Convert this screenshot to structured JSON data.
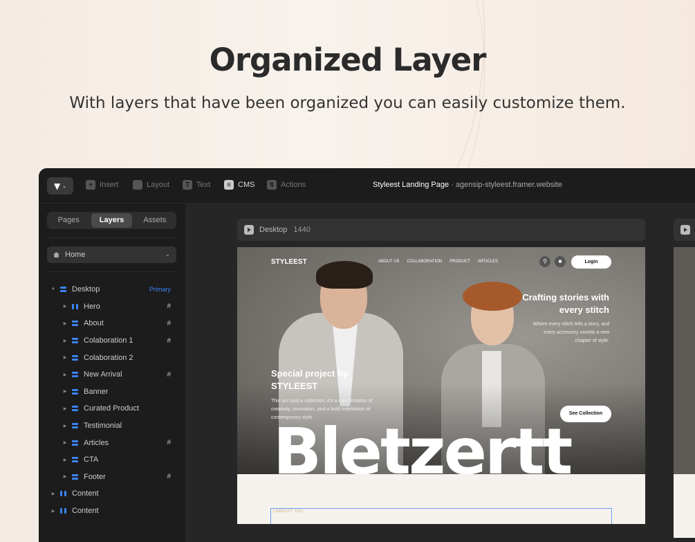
{
  "header": {
    "title": "Organized Layer",
    "subtitle": "With layers that have been organized you can easily customize them."
  },
  "toolbar": {
    "insert": "Insert",
    "layout": "Layout",
    "text": "Text",
    "cms": "CMS",
    "actions": "Actions",
    "project_title": "Styleest Landing Page",
    "project_url": "agensip-styleest.framer.website"
  },
  "sidebar": {
    "tabs": [
      "Pages",
      "Layers",
      "Assets"
    ],
    "page_select": "Home",
    "root": {
      "label": "Desktop",
      "tag": "Primary"
    },
    "layers": [
      {
        "label": "Hero",
        "hash": "#"
      },
      {
        "label": "About",
        "hash": "#"
      },
      {
        "label": "Colaboration 1",
        "hash": "#"
      },
      {
        "label": "Colaboration 2",
        "hash": ""
      },
      {
        "label": "New Arrival",
        "hash": "#"
      },
      {
        "label": "Banner",
        "hash": ""
      },
      {
        "label": "Curated Product",
        "hash": ""
      },
      {
        "label": "Testimonial",
        "hash": ""
      },
      {
        "label": "Articles",
        "hash": "#"
      },
      {
        "label": "CTA",
        "hash": ""
      },
      {
        "label": "Footer",
        "hash": "#"
      }
    ],
    "bottom_items": [
      "Content",
      "Content"
    ]
  },
  "canvas": {
    "frame_name": "Desktop",
    "frame_size": "1440"
  },
  "site": {
    "brand": "STYLEEST",
    "nav_links": [
      "ABOUT US",
      "COLLABORATION",
      "PRODUCT",
      "ARTICLES"
    ],
    "login": "Login",
    "craft_heading": "Crafting stories with every stitch",
    "craft_text": "Where every stitch tells a story, and every accessory unveils a new chapter of style.",
    "special_heading": "Special project by STYLEEST",
    "special_text": "This isn't just a collection, it's a manifestation of creativity, innovation, and a bold redefinition of contemporary style.",
    "see_collection": "See Collection",
    "big_word": "Bletzertt",
    "about_label": "(ABOUT US)"
  }
}
